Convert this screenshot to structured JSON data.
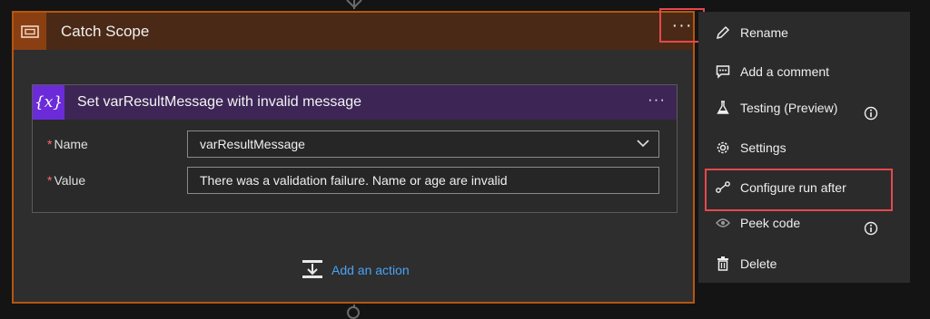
{
  "scope": {
    "title": "Catch Scope",
    "menu_glyph": "···"
  },
  "action": {
    "icon_text": "{x}",
    "title": "Set varResultMessage with invalid message",
    "menu_glyph": "···",
    "fields": [
      {
        "label": "Name",
        "required_mark": "*",
        "value": "varResultMessage",
        "type": "dropdown"
      },
      {
        "label": "Value",
        "required_mark": "*",
        "value": "There was a validation failure. Name or age are invalid",
        "type": "text"
      }
    ]
  },
  "add_action_label": "Add an action",
  "context_menu": {
    "items": [
      {
        "label": "Rename",
        "icon": "pencil-icon"
      },
      {
        "label": "Add a comment",
        "icon": "comment-icon"
      },
      {
        "label": "Testing (Preview)",
        "icon": "flask-icon",
        "info": true
      },
      {
        "label": "Settings",
        "icon": "gear-icon"
      },
      {
        "label": "Configure run after",
        "icon": "run-after-icon",
        "highlighted": true
      },
      {
        "label": "Peek code",
        "icon": "eye-icon",
        "info": true
      },
      {
        "label": "Delete",
        "icon": "trash-icon"
      }
    ]
  },
  "colors": {
    "scope_border": "#b5560f",
    "scope_header": "#4a2a16",
    "action_header": "#3d2656",
    "variable_icon": "#6c2bd9",
    "highlight": "#e5484d",
    "link": "#4aa3f5"
  }
}
